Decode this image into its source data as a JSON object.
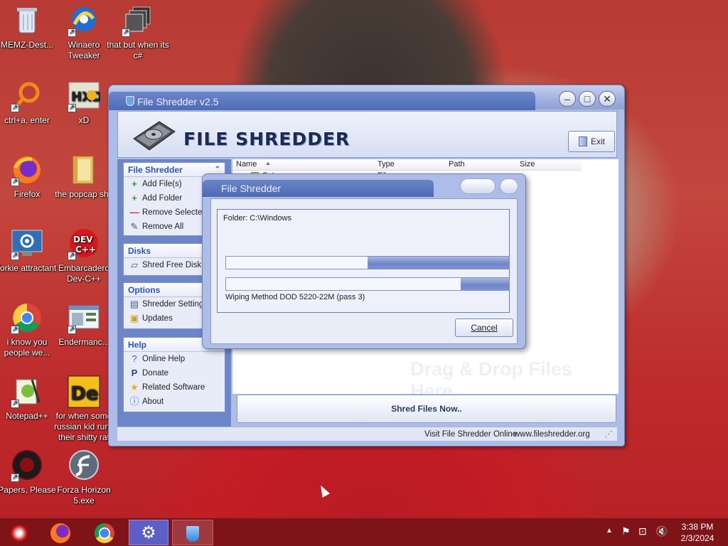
{
  "desktop": {
    "icons": [
      {
        "label": "MEMZ-Dest...",
        "icon": "recycle-bin-icon"
      },
      {
        "label": "Winaero Tweaker",
        "icon": "winaero-icon"
      },
      {
        "label": "that but when its c#",
        "icon": "stacked-windows-icon"
      },
      {
        "label": "ctrl+a, enter",
        "icon": "orange-circle-icon"
      },
      {
        "label": "xD",
        "icon": "hxd-icon"
      },
      {
        "label": "Firefox",
        "icon": "firefox-icon"
      },
      {
        "label": "the popcap shit",
        "icon": "folder-icon"
      },
      {
        "label": "forkie attractant",
        "icon": "monitor-gear-icon"
      },
      {
        "label": "Embarcadero Dev-C++",
        "icon": "devcpp-icon"
      },
      {
        "label": "i know you people we...",
        "icon": "chrome-icon"
      },
      {
        "label": "Endermanc...",
        "icon": "window-app-icon"
      },
      {
        "label": "Notepad++",
        "icon": "notepadpp-icon"
      },
      {
        "label": "for when some russian kid runs their shitty rat",
        "icon": "de-icon"
      },
      {
        "label": "Papers, Please",
        "icon": "papers-please-icon"
      },
      {
        "label": "Forza Horizon 5.exe",
        "icon": "flash-icon"
      }
    ]
  },
  "window": {
    "title": "File Shredder v2.5",
    "header_title": "FILE SHREDDER",
    "exit_label": "Exit",
    "panels": {
      "file_shredder": {
        "title": "File Shredder",
        "items": [
          "Add File(s)",
          "Add Folder",
          "Remove Selected",
          "Remove All"
        ]
      },
      "disks": {
        "title": "Disks",
        "items": [
          "Shred Free Disk S"
        ]
      },
      "options": {
        "title": "Options",
        "items": [
          "Shredder Setting",
          "Updates"
        ]
      },
      "help": {
        "title": "Help",
        "items": [
          "Online Help",
          "Donate",
          "Related Software",
          "About"
        ]
      }
    },
    "columns": [
      "Name",
      "Type",
      "Path",
      "Size"
    ],
    "row": {
      "name": "Setup",
      "type": "File"
    },
    "drag_hint": "Drag & Drop Files Here",
    "shred_label": "Shred Files Now..",
    "status_link": "Visit File Shredder Online",
    "status_url": "www.fileshredder.org"
  },
  "dialog": {
    "title": "File Shredder",
    "folder_text": "Folder: C:\\Windows",
    "progress1": 0.5,
    "progress2": 0.17,
    "method_text": "Wiping Method DOD 5220-22M  (pass 3)",
    "cancel_label": "Cancel"
  },
  "taskbar": {
    "apps": [
      "start-icon",
      "firefox-icon",
      "chrome-icon",
      "settings-icon",
      "file-shredder-icon"
    ],
    "time": "3:38 PM",
    "date": "2/3/2024"
  },
  "colors": {
    "accent": "#4d6ab5",
    "taskbar": "#7e1318"
  }
}
